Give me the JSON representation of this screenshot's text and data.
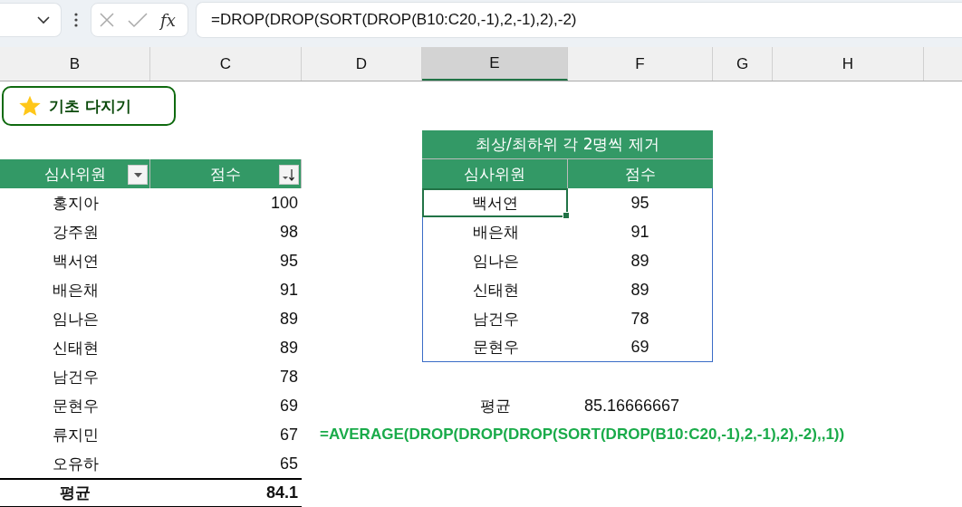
{
  "formula_bar": {
    "function_label": "fx",
    "formula": "=DROP(DROP(SORT(DROP(B10:C20,-1),2,-1),2),-2)"
  },
  "column_headers": [
    {
      "label": "B",
      "selected": false
    },
    {
      "label": "C",
      "selected": false
    },
    {
      "label": "D",
      "selected": false
    },
    {
      "label": "E",
      "selected": true
    },
    {
      "label": "F",
      "selected": false
    },
    {
      "label": "G",
      "selected": false
    },
    {
      "label": "H",
      "selected": false
    }
  ],
  "badge": {
    "text": "기초 다지기"
  },
  "left_table": {
    "columns": [
      {
        "label": "심사위원",
        "kind": "dropdown"
      },
      {
        "label": "점수",
        "kind": "sorted_desc"
      }
    ],
    "rows": [
      {
        "name": "홍지아",
        "score": "100"
      },
      {
        "name": "강주원",
        "score": "98"
      },
      {
        "name": "백서연",
        "score": "95"
      },
      {
        "name": "배은채",
        "score": "91"
      },
      {
        "name": "임나은",
        "score": "89"
      },
      {
        "name": "신태현",
        "score": "89"
      },
      {
        "name": "남건우",
        "score": "78"
      },
      {
        "name": "문현우",
        "score": "69"
      },
      {
        "name": "류지민",
        "score": "67"
      },
      {
        "name": "오유하",
        "score": "65"
      }
    ],
    "total": {
      "label": "평균",
      "value": "84.1"
    }
  },
  "right_table": {
    "title": "최상/최하위 각 2명씩 제거",
    "columns": [
      "심사위원",
      "점수"
    ],
    "rows": [
      {
        "name": "백서연",
        "score": "95",
        "selected": true
      },
      {
        "name": "배은채",
        "score": "91",
        "selected": false
      },
      {
        "name": "임나은",
        "score": "89",
        "selected": false
      },
      {
        "name": "신태현",
        "score": "89",
        "selected": false
      },
      {
        "name": "남건우",
        "score": "78",
        "selected": false
      },
      {
        "name": "문현우",
        "score": "69",
        "selected": false
      }
    ]
  },
  "average": {
    "label": "평균",
    "value": "85.16666667"
  },
  "formula_text": "=AVERAGE(DROP(DROP(DROP(SORT(DROP(B10:C20,-1),2,-1),2),-2),,1))"
}
